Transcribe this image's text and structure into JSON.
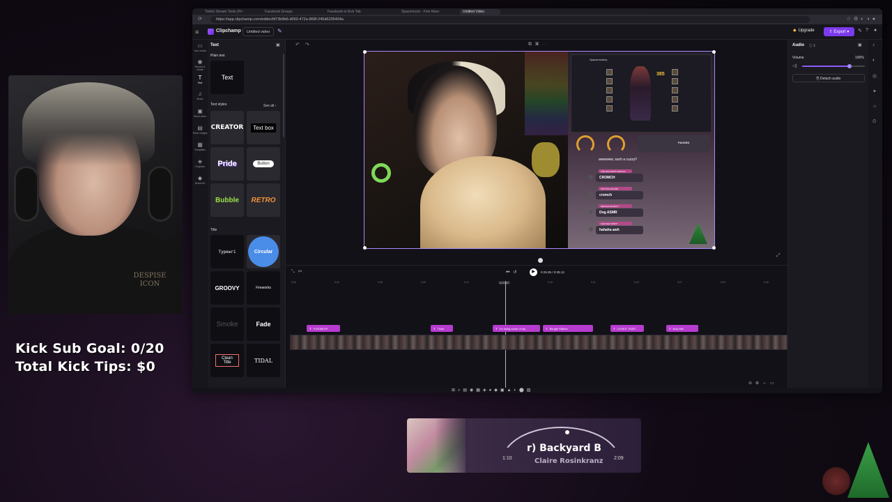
{
  "overlay": {
    "sub_goal": "Kick Sub Goal: 0/20",
    "tips": "Total Kick Tips: $0"
  },
  "browser": {
    "tabs": [
      "Twitch Stream Tools (Pro)",
      "Facebook Groups",
      "Facebook to Kick Tab",
      "Spacemusic - Fine Manage",
      "Untitled Video"
    ],
    "url": "https://app.clipchamp.com/editor/bf73b9b6-d063-472a-868f-245d6235404a"
  },
  "app": {
    "brand": "Clipchamp",
    "video_title": "Untitled video",
    "upgrade_label": "Upgrade",
    "export_label": "Export"
  },
  "rail": [
    {
      "icon": "media-icon",
      "glyph": "▭",
      "label": "Your media"
    },
    {
      "icon": "record-icon",
      "glyph": "◉",
      "label": "Record & create"
    },
    {
      "icon": "text-icon",
      "glyph": "T",
      "label": "Text"
    },
    {
      "icon": "music-icon",
      "glyph": "♫",
      "label": "Music"
    },
    {
      "icon": "video-icon",
      "glyph": "▣",
      "label": "Stock video"
    },
    {
      "icon": "image-icon",
      "glyph": "▤",
      "label": "Stock images"
    },
    {
      "icon": "templates-icon",
      "glyph": "▦",
      "label": "Templates"
    },
    {
      "icon": "graphics-icon",
      "glyph": "◈",
      "label": "Graphics"
    },
    {
      "icon": "brand-icon",
      "glyph": "◆",
      "label": "Brand kit"
    }
  ],
  "text_panel": {
    "title": "Text",
    "plain_text_heading": "Plain text",
    "plain_text_tile": "Text",
    "text_styles_heading": "Text styles",
    "see_all": "See all",
    "styles": [
      "CREATOR",
      "Text box",
      "Pride",
      "Button",
      "Bubble",
      "RETRO"
    ],
    "title_heading": "Title",
    "titles": [
      "Typewri",
      "Circular",
      "GROOVY",
      "Fireworks",
      "Smoke",
      "Fade",
      "Clean Title",
      "TIDAL"
    ]
  },
  "preview": {
    "game_title": "Spacemonkey",
    "game_score": "385",
    "paused_label": "PAUSED",
    "chat": [
      {
        "badge": "",
        "text": "awwwww, such a cuzzy!!"
      },
      {
        "badge": "THE MOLASKIS ORACLE",
        "text": "CROMCH"
      },
      {
        "badge": "CRYSTAL BOUND",
        "text": "cromch"
      },
      {
        "badge": "MIRAGE MAJESTY",
        "text": "Dog ASMR"
      },
      {
        "badge": "FEATHER SPIRIT",
        "text": "hahaha awh"
      }
    ]
  },
  "timeline": {
    "timecode": "0:25.05 / 0:39.13",
    "playhead_label": "0:21.37",
    "ruler": [
      "0:00",
      "0:03",
      "0:06",
      "0:09",
      "0:12",
      "0:15",
      "0:18",
      "0:21",
      "0:24",
      "0:27",
      "0:30",
      "0:33",
      "0:36",
      "0:39"
    ],
    "clips": [
      "*CROMCH*",
      "Thwe",
      "I'm using some of my",
      "Bungle Silkies!",
      "LOOKIT THAT!",
      "Now kith"
    ]
  },
  "audio_panel": {
    "title": "Audio",
    "volume_label": "Volume",
    "volume_value": "100%",
    "volume_level": 0.75,
    "detach_label": "Detach audio"
  },
  "now_playing": {
    "title": "r)    Backyard B",
    "artist": "Claire Rosinkranz",
    "start": "1:10",
    "end": "2:09",
    "progress": 0.54
  }
}
